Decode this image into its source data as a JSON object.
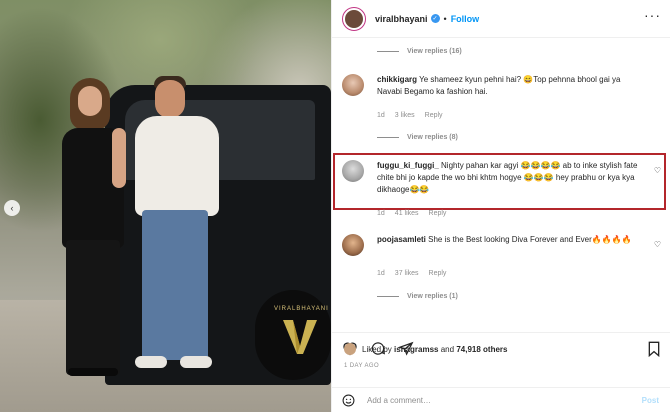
{
  "header": {
    "username": "viralbhayani",
    "follow_label": "Follow",
    "dot": "•",
    "more_icon": "more-icon"
  },
  "media": {
    "watermark": "VIRALBHAYANI"
  },
  "comments": {
    "view_replies_1": "View replies (16)",
    "view_replies_2": "View replies (8)",
    "view_replies_3": "View replies (1)",
    "items": [
      {
        "user": "chikkigarg",
        "text": "Ye shameez kyun pehni hai? 😄Top pehnna bhool gai ya Navabi Begamo ka fashion hai.",
        "age": "1d",
        "likes": "3 likes",
        "reply": "Reply"
      },
      {
        "user": "fuggu_ki_fuggi_",
        "text": "Nighty pahan kar agyi 😂😂😂😂 ab to inke stylish fate chite bhi jo kapde the wo bhi khtm hogye 😂😂😂 hey prabhu or kya kya dikhaoge😂😂",
        "age": "1d",
        "likes": "41 likes",
        "reply": "Reply"
      },
      {
        "user": "poojasamleti",
        "text": "She is the Best looking Diva Forever and Ever🔥🔥🔥🔥",
        "age": "1d",
        "likes": "37 likes",
        "reply": "Reply"
      }
    ]
  },
  "actions": {
    "liked_by_prefix": "Liked by",
    "liked_by_user": "ishagramss",
    "liked_by_and": "and",
    "liked_by_count": "74,918 others",
    "time": "1 DAY AGO",
    "add_comment_placeholder": "Add a comment…",
    "post_label": "Post"
  },
  "colors": {
    "highlight": "#b3262b",
    "link": "#0095f6"
  }
}
